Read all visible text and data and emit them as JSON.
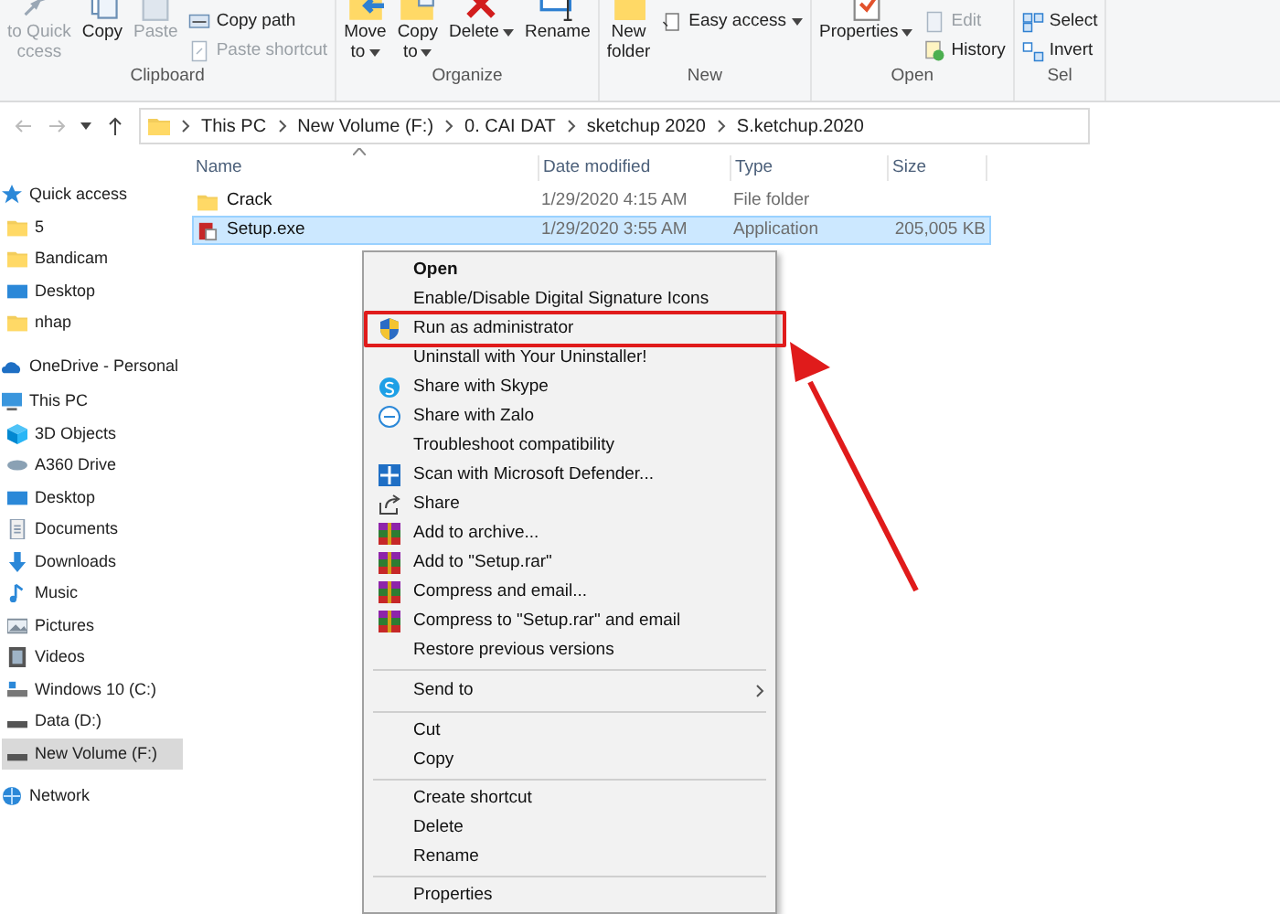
{
  "ribbon": {
    "groups": [
      {
        "label": "Clipboard",
        "large": [
          {
            "lines": [
              "to Quick",
              "ccess"
            ],
            "kind": "pin",
            "disabled": true,
            "dropdown": false
          },
          {
            "lines": [
              "Copy"
            ],
            "kind": "copy",
            "disabled": false,
            "dropdown": false
          },
          {
            "lines": [
              "Paste"
            ],
            "kind": "paste",
            "disabled": true,
            "dropdown": false
          }
        ],
        "small": [
          {
            "label": "Copy path",
            "kind": "path",
            "disabled": false,
            "dropdown": false
          },
          {
            "label": "Paste shortcut",
            "kind": "shortcut",
            "disabled": true,
            "dropdown": false
          }
        ]
      },
      {
        "label": "Organize",
        "large": [
          {
            "lines": [
              "Move",
              "to"
            ],
            "kind": "move",
            "disabled": false,
            "dropdown": true
          },
          {
            "lines": [
              "Copy",
              "to"
            ],
            "kind": "copyto",
            "disabled": false,
            "dropdown": true
          },
          {
            "lines": [
              "Delete"
            ],
            "kind": "delete",
            "disabled": false,
            "dropdown": true
          },
          {
            "lines": [
              "Rename"
            ],
            "kind": "rename",
            "disabled": false,
            "dropdown": false
          }
        ]
      },
      {
        "label": "New",
        "large": [
          {
            "lines": [
              "New",
              "folder"
            ],
            "kind": "folder",
            "disabled": false,
            "dropdown": false
          }
        ],
        "small": [
          {
            "label": "Easy access",
            "kind": "easy",
            "disabled": false,
            "dropdown": true
          }
        ]
      },
      {
        "label": "Open",
        "large": [
          {
            "lines": [
              "Properties"
            ],
            "kind": "properties",
            "disabled": false,
            "dropdown": true
          }
        ],
        "small": [
          {
            "label": "Edit",
            "kind": "edit",
            "disabled": true,
            "dropdown": false
          },
          {
            "label": "History",
            "kind": "history",
            "disabled": false,
            "dropdown": false
          }
        ]
      },
      {
        "label": "Sel",
        "small": [
          {
            "label": "Select",
            "kind": "select",
            "disabled": false,
            "dropdown": false
          },
          {
            "label": "Invert",
            "kind": "invert",
            "disabled": false,
            "dropdown": false
          }
        ]
      }
    ]
  },
  "address_bar": {
    "path": [
      "This PC",
      "New Volume (F:)",
      "0. CAI DAT",
      "sketchup 2020",
      "S.ketchup.2020"
    ]
  },
  "sidebar": {
    "items": [
      {
        "label": "Quick access",
        "kind": "star",
        "selected": false,
        "children": [
          {
            "label": "5",
            "kind": "folder",
            "selected": false
          },
          {
            "label": "Bandicam",
            "kind": "folder",
            "selected": false
          },
          {
            "label": "Desktop",
            "kind": "desktop",
            "selected": false
          },
          {
            "label": "nhap",
            "kind": "folder",
            "selected": false
          }
        ]
      },
      {
        "label": "OneDrive - Personal",
        "kind": "cloud",
        "selected": false
      },
      {
        "label": "This PC",
        "kind": "pc",
        "selected": false,
        "children": [
          {
            "label": "3D Objects",
            "kind": "cube",
            "selected": false
          },
          {
            "label": "A360 Drive",
            "kind": "a360",
            "selected": false
          },
          {
            "label": "Desktop",
            "kind": "desktop",
            "selected": false
          },
          {
            "label": "Documents",
            "kind": "docs",
            "selected": false
          },
          {
            "label": "Downloads",
            "kind": "download",
            "selected": false
          },
          {
            "label": "Music",
            "kind": "music",
            "selected": false
          },
          {
            "label": "Pictures",
            "kind": "pictures",
            "selected": false
          },
          {
            "label": "Videos",
            "kind": "videos",
            "selected": false
          },
          {
            "label": "Windows 10 (C:)",
            "kind": "windisk",
            "selected": false
          },
          {
            "label": "Data (D:)",
            "kind": "disk",
            "selected": false
          },
          {
            "label": "New Volume (F:)",
            "kind": "disk",
            "selected": true
          }
        ]
      },
      {
        "label": "Network",
        "kind": "network",
        "selected": false
      }
    ]
  },
  "file_list": {
    "columns": [
      "Name",
      "Date modified",
      "Type",
      "Size"
    ],
    "rows": [
      {
        "name": "Crack",
        "date": "1/29/2020 4:15 AM",
        "type": "File folder",
        "size": "",
        "kind": "folder",
        "selected": false
      },
      {
        "name": "Setup.exe",
        "date": "1/29/2020 3:55 AM",
        "type": "Application",
        "size": "205,005 KB",
        "kind": "exe",
        "selected": true
      }
    ]
  },
  "context_menu": {
    "items": [
      {
        "kind": "plain",
        "label": "Open",
        "bold": true,
        "annotated": false
      },
      {
        "kind": "plain",
        "label": "Enable/Disable Digital Signature Icons",
        "bold": false,
        "annotated": false
      },
      {
        "kind": "shield",
        "label": "Run as administrator",
        "bold": false,
        "annotated": true
      },
      {
        "kind": "plain",
        "label": "Uninstall with Your Uninstaller!",
        "bold": false,
        "annotated": false
      },
      {
        "kind": "skype",
        "label": "Share with Skype",
        "bold": false,
        "annotated": false
      },
      {
        "kind": "zalo",
        "label": "Share with Zalo",
        "bold": false,
        "annotated": false
      },
      {
        "kind": "plain",
        "label": "Troubleshoot compatibility",
        "bold": false,
        "annotated": false
      },
      {
        "kind": "defender",
        "label": "Scan with Microsoft Defender...",
        "bold": false,
        "annotated": false
      },
      {
        "kind": "share",
        "label": "Share",
        "bold": false,
        "annotated": false
      },
      {
        "kind": "winrar",
        "label": "Add to archive...",
        "bold": false,
        "annotated": false
      },
      {
        "kind": "winrar",
        "label": "Add to \"Setup.rar\"",
        "bold": false,
        "annotated": false
      },
      {
        "kind": "winrar",
        "label": "Compress and email...",
        "bold": false,
        "annotated": false
      },
      {
        "kind": "winrar",
        "label": "Compress to \"Setup.rar\" and email",
        "bold": false,
        "annotated": false
      },
      {
        "kind": "plain",
        "label": "Restore previous versions",
        "bold": false,
        "annotated": false
      },
      {
        "kind": "separator"
      },
      {
        "kind": "submenu",
        "label": "Send to",
        "bold": false,
        "annotated": false
      },
      {
        "kind": "separator"
      },
      {
        "kind": "plain",
        "label": "Cut",
        "bold": false,
        "annotated": false
      },
      {
        "kind": "plain",
        "label": "Copy",
        "bold": false,
        "annotated": false
      },
      {
        "kind": "separator"
      },
      {
        "kind": "plain",
        "label": "Create shortcut",
        "bold": false,
        "annotated": false
      },
      {
        "kind": "plain",
        "label": "Delete",
        "bold": false,
        "annotated": false
      },
      {
        "kind": "plain",
        "label": "Rename",
        "bold": false,
        "annotated": false
      },
      {
        "kind": "separator"
      },
      {
        "kind": "plain",
        "label": "Properties",
        "bold": false,
        "annotated": false
      }
    ]
  }
}
